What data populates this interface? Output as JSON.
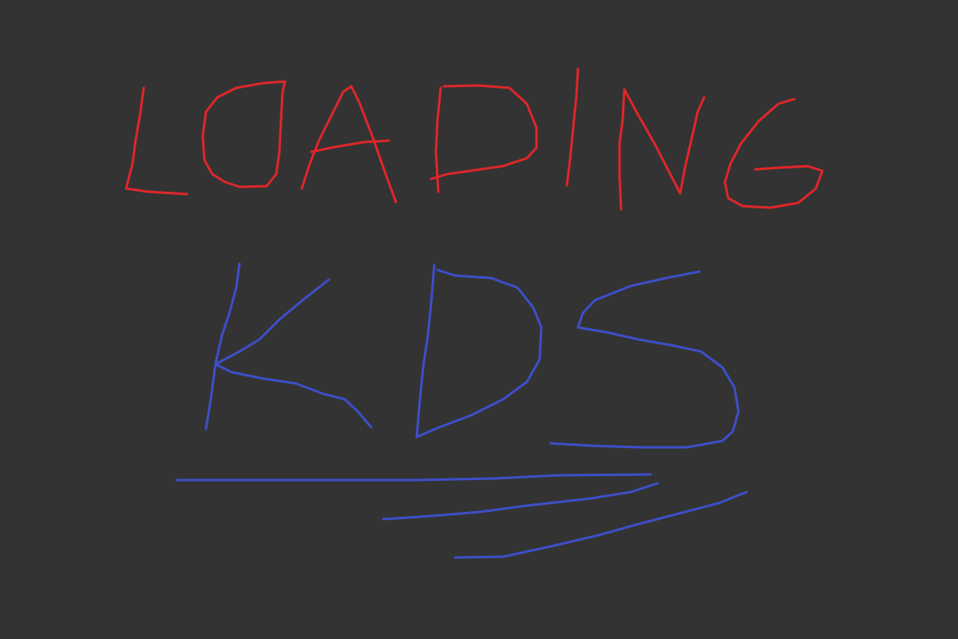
{
  "screen": {
    "background_color": "#333333"
  },
  "loading_word": {
    "text": "LOADING",
    "color": "#e0262a"
  },
  "app_word": {
    "text": "KDS",
    "color": "#3d4fc9"
  },
  "speed_lines": {
    "color": "#3d4fc9",
    "count": 3
  }
}
